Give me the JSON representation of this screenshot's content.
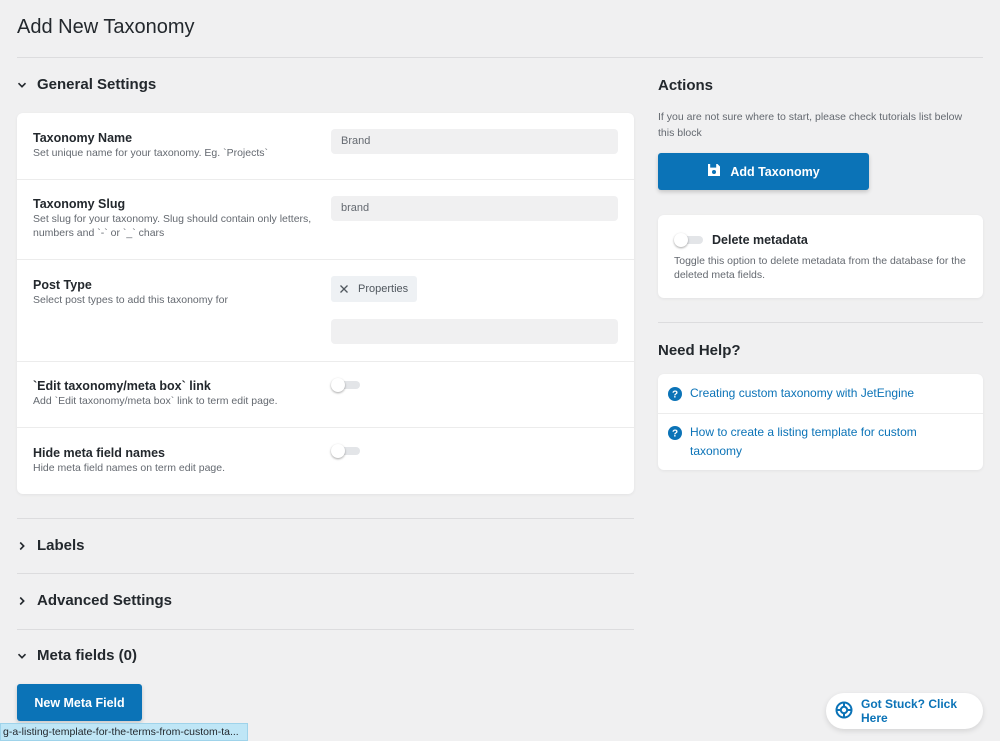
{
  "page": {
    "title": "Add New Taxonomy"
  },
  "general": {
    "title": "General Settings",
    "fields": {
      "name": {
        "label": "Taxonomy Name",
        "desc": "Set unique name for your taxonomy. Eg. `Projects`",
        "placeholder": "Brand"
      },
      "slug": {
        "label": "Taxonomy Slug",
        "desc": "Set slug for your taxonomy. Slug should contain only letters, numbers and `-` or `_` chars",
        "placeholder": "brand"
      },
      "post_type": {
        "label": "Post Type",
        "desc": "Select post types to add this taxonomy for",
        "selected": "Properties"
      },
      "edit_link": {
        "label": "`Edit taxonomy/meta box` link",
        "desc": "Add `Edit taxonomy/meta box` link to term edit page."
      },
      "hide_meta": {
        "label": "Hide meta field names",
        "desc": "Hide meta field names on term edit page."
      }
    }
  },
  "sections": {
    "labels": "Labels",
    "advanced": "Advanced Settings",
    "meta": "Meta fields (0)"
  },
  "buttons": {
    "new_meta": "New Meta Field",
    "add_taxonomy": "Add Taxonomy"
  },
  "actions": {
    "title": "Actions",
    "hint": "If you are not sure where to start, please check tutorials list below this block",
    "delete_meta": {
      "label": "Delete metadata",
      "desc": "Toggle this option to delete metadata from the database for the deleted meta fields."
    }
  },
  "help": {
    "title": "Need Help?",
    "links": [
      "Creating custom taxonomy with JetEngine",
      "How to create a listing template for custom taxonomy"
    ]
  },
  "stuck": {
    "label": "Got Stuck? Click Here"
  },
  "status_bar": {
    "url": "g-a-listing-template-for-the-terms-from-custom-ta..."
  },
  "colors": {
    "accent": "#0b73b7",
    "background": "#f0f0f1"
  }
}
